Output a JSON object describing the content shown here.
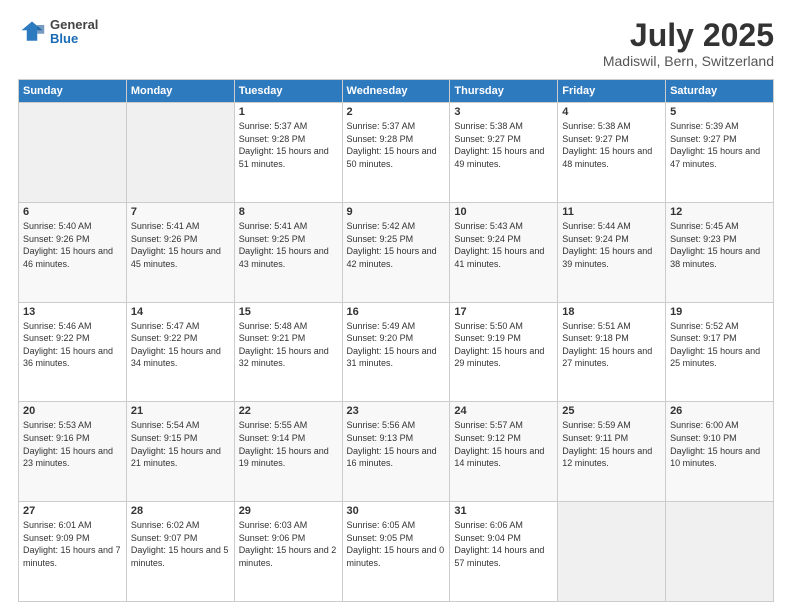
{
  "header": {
    "logo": {
      "general": "General",
      "blue": "Blue"
    },
    "title": "July 2025",
    "location": "Madiswil, Bern, Switzerland"
  },
  "weekdays": [
    "Sunday",
    "Monday",
    "Tuesday",
    "Wednesday",
    "Thursday",
    "Friday",
    "Saturday"
  ],
  "weeks": [
    [
      {
        "day": "",
        "empty": true
      },
      {
        "day": "",
        "empty": true
      },
      {
        "day": "1",
        "sunrise": "Sunrise: 5:37 AM",
        "sunset": "Sunset: 9:28 PM",
        "daylight": "Daylight: 15 hours and 51 minutes."
      },
      {
        "day": "2",
        "sunrise": "Sunrise: 5:37 AM",
        "sunset": "Sunset: 9:28 PM",
        "daylight": "Daylight: 15 hours and 50 minutes."
      },
      {
        "day": "3",
        "sunrise": "Sunrise: 5:38 AM",
        "sunset": "Sunset: 9:27 PM",
        "daylight": "Daylight: 15 hours and 49 minutes."
      },
      {
        "day": "4",
        "sunrise": "Sunrise: 5:38 AM",
        "sunset": "Sunset: 9:27 PM",
        "daylight": "Daylight: 15 hours and 48 minutes."
      },
      {
        "day": "5",
        "sunrise": "Sunrise: 5:39 AM",
        "sunset": "Sunset: 9:27 PM",
        "daylight": "Daylight: 15 hours and 47 minutes."
      }
    ],
    [
      {
        "day": "6",
        "sunrise": "Sunrise: 5:40 AM",
        "sunset": "Sunset: 9:26 PM",
        "daylight": "Daylight: 15 hours and 46 minutes."
      },
      {
        "day": "7",
        "sunrise": "Sunrise: 5:41 AM",
        "sunset": "Sunset: 9:26 PM",
        "daylight": "Daylight: 15 hours and 45 minutes."
      },
      {
        "day": "8",
        "sunrise": "Sunrise: 5:41 AM",
        "sunset": "Sunset: 9:25 PM",
        "daylight": "Daylight: 15 hours and 43 minutes."
      },
      {
        "day": "9",
        "sunrise": "Sunrise: 5:42 AM",
        "sunset": "Sunset: 9:25 PM",
        "daylight": "Daylight: 15 hours and 42 minutes."
      },
      {
        "day": "10",
        "sunrise": "Sunrise: 5:43 AM",
        "sunset": "Sunset: 9:24 PM",
        "daylight": "Daylight: 15 hours and 41 minutes."
      },
      {
        "day": "11",
        "sunrise": "Sunrise: 5:44 AM",
        "sunset": "Sunset: 9:24 PM",
        "daylight": "Daylight: 15 hours and 39 minutes."
      },
      {
        "day": "12",
        "sunrise": "Sunrise: 5:45 AM",
        "sunset": "Sunset: 9:23 PM",
        "daylight": "Daylight: 15 hours and 38 minutes."
      }
    ],
    [
      {
        "day": "13",
        "sunrise": "Sunrise: 5:46 AM",
        "sunset": "Sunset: 9:22 PM",
        "daylight": "Daylight: 15 hours and 36 minutes."
      },
      {
        "day": "14",
        "sunrise": "Sunrise: 5:47 AM",
        "sunset": "Sunset: 9:22 PM",
        "daylight": "Daylight: 15 hours and 34 minutes."
      },
      {
        "day": "15",
        "sunrise": "Sunrise: 5:48 AM",
        "sunset": "Sunset: 9:21 PM",
        "daylight": "Daylight: 15 hours and 32 minutes."
      },
      {
        "day": "16",
        "sunrise": "Sunrise: 5:49 AM",
        "sunset": "Sunset: 9:20 PM",
        "daylight": "Daylight: 15 hours and 31 minutes."
      },
      {
        "day": "17",
        "sunrise": "Sunrise: 5:50 AM",
        "sunset": "Sunset: 9:19 PM",
        "daylight": "Daylight: 15 hours and 29 minutes."
      },
      {
        "day": "18",
        "sunrise": "Sunrise: 5:51 AM",
        "sunset": "Sunset: 9:18 PM",
        "daylight": "Daylight: 15 hours and 27 minutes."
      },
      {
        "day": "19",
        "sunrise": "Sunrise: 5:52 AM",
        "sunset": "Sunset: 9:17 PM",
        "daylight": "Daylight: 15 hours and 25 minutes."
      }
    ],
    [
      {
        "day": "20",
        "sunrise": "Sunrise: 5:53 AM",
        "sunset": "Sunset: 9:16 PM",
        "daylight": "Daylight: 15 hours and 23 minutes."
      },
      {
        "day": "21",
        "sunrise": "Sunrise: 5:54 AM",
        "sunset": "Sunset: 9:15 PM",
        "daylight": "Daylight: 15 hours and 21 minutes."
      },
      {
        "day": "22",
        "sunrise": "Sunrise: 5:55 AM",
        "sunset": "Sunset: 9:14 PM",
        "daylight": "Daylight: 15 hours and 19 minutes."
      },
      {
        "day": "23",
        "sunrise": "Sunrise: 5:56 AM",
        "sunset": "Sunset: 9:13 PM",
        "daylight": "Daylight: 15 hours and 16 minutes."
      },
      {
        "day": "24",
        "sunrise": "Sunrise: 5:57 AM",
        "sunset": "Sunset: 9:12 PM",
        "daylight": "Daylight: 15 hours and 14 minutes."
      },
      {
        "day": "25",
        "sunrise": "Sunrise: 5:59 AM",
        "sunset": "Sunset: 9:11 PM",
        "daylight": "Daylight: 15 hours and 12 minutes."
      },
      {
        "day": "26",
        "sunrise": "Sunrise: 6:00 AM",
        "sunset": "Sunset: 9:10 PM",
        "daylight": "Daylight: 15 hours and 10 minutes."
      }
    ],
    [
      {
        "day": "27",
        "sunrise": "Sunrise: 6:01 AM",
        "sunset": "Sunset: 9:09 PM",
        "daylight": "Daylight: 15 hours and 7 minutes."
      },
      {
        "day": "28",
        "sunrise": "Sunrise: 6:02 AM",
        "sunset": "Sunset: 9:07 PM",
        "daylight": "Daylight: 15 hours and 5 minutes."
      },
      {
        "day": "29",
        "sunrise": "Sunrise: 6:03 AM",
        "sunset": "Sunset: 9:06 PM",
        "daylight": "Daylight: 15 hours and 2 minutes."
      },
      {
        "day": "30",
        "sunrise": "Sunrise: 6:05 AM",
        "sunset": "Sunset: 9:05 PM",
        "daylight": "Daylight: 15 hours and 0 minutes."
      },
      {
        "day": "31",
        "sunrise": "Sunrise: 6:06 AM",
        "sunset": "Sunset: 9:04 PM",
        "daylight": "Daylight: 14 hours and 57 minutes."
      },
      {
        "day": "",
        "empty": true
      },
      {
        "day": "",
        "empty": true
      }
    ]
  ]
}
